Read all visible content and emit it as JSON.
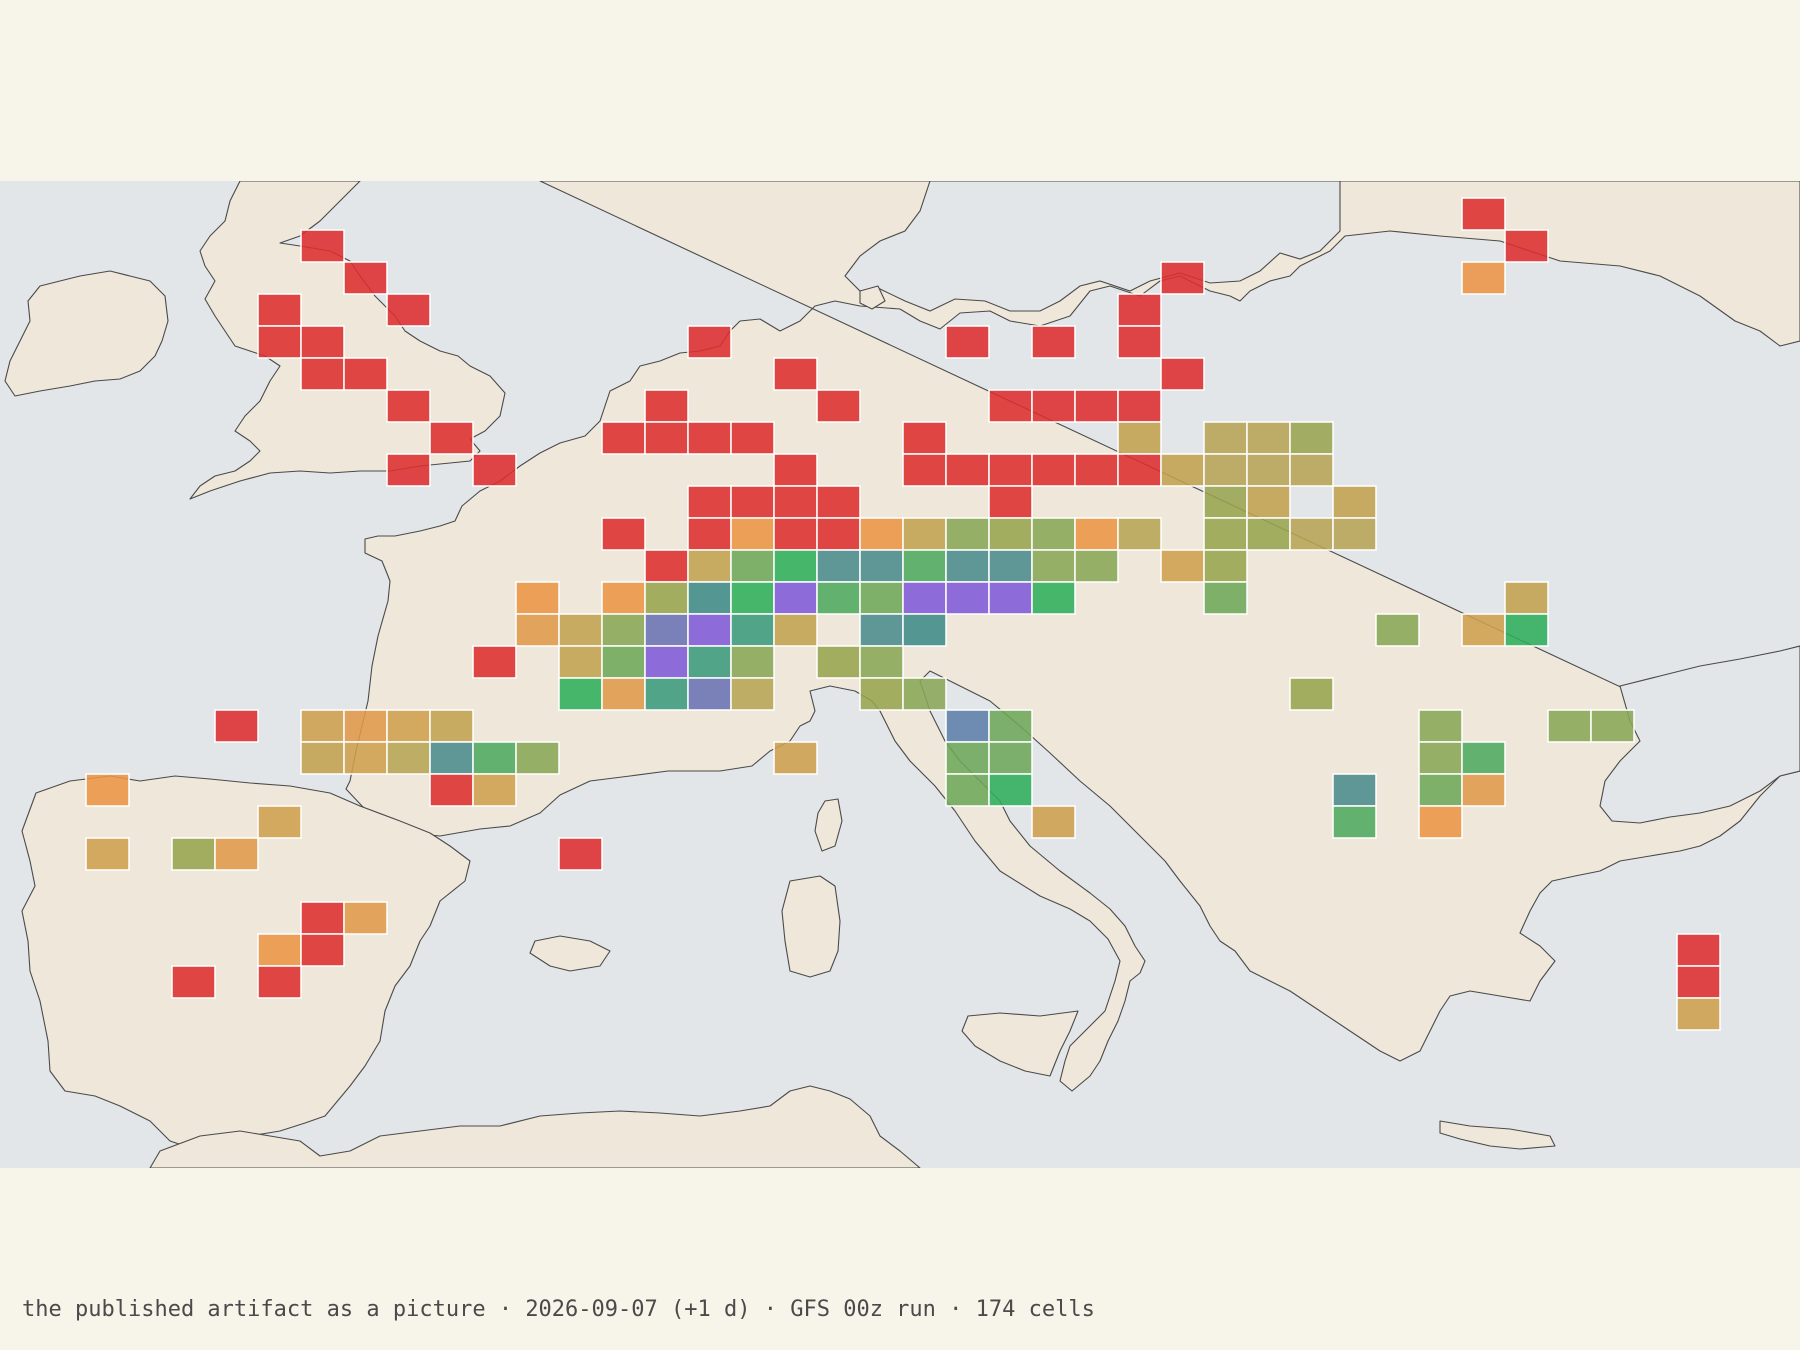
{
  "map": {
    "colors": {
      "page_background": "#f7f4ea",
      "sea": "#e3e6e8",
      "land": "#efe8da",
      "coastline": "#4a4a4a",
      "cell_border": "#ffffff"
    },
    "cell_count": 174,
    "palette": {
      "r": "#dd2e2e",
      "o": "#ec9444",
      "q": "#e0984a",
      "t": "#ce9f4c",
      "k": "#c2a24e",
      "y": "#b7a454",
      "v": "#98a44f",
      "g": "#8aa656",
      "l": "#6ea75a",
      "m": "#4fa85e",
      "e": "#2fae5b",
      "c": "#3b9a7b",
      "s": "#4a8b8c",
      "n": "#3d8a88",
      "b": "#5d7fa8",
      "i": "#6a72b4",
      "u": "#7f5ad8"
    },
    "cells": [
      [
        7,
        3,
        "r"
      ],
      [
        8,
        4,
        "r"
      ],
      [
        6,
        5,
        "r"
      ],
      [
        9,
        5,
        "r"
      ],
      [
        6,
        6,
        "r"
      ],
      [
        7,
        6,
        "r"
      ],
      [
        7,
        7,
        "r"
      ],
      [
        8,
        7,
        "r"
      ],
      [
        9,
        8,
        "r"
      ],
      [
        10,
        9,
        "r"
      ],
      [
        9,
        10,
        "r"
      ],
      [
        11,
        10,
        "r"
      ],
      [
        34,
        2,
        "r"
      ],
      [
        35,
        3,
        "r"
      ],
      [
        34,
        4,
        "o"
      ],
      [
        27,
        4,
        "r"
      ],
      [
        26,
        5,
        "r"
      ],
      [
        16,
        6,
        "r"
      ],
      [
        22,
        6,
        "r"
      ],
      [
        24,
        6,
        "r"
      ],
      [
        26,
        6,
        "r"
      ],
      [
        18,
        7,
        "r"
      ],
      [
        27,
        7,
        "r"
      ],
      [
        15,
        8,
        "r"
      ],
      [
        19,
        8,
        "r"
      ],
      [
        23,
        8,
        "r"
      ],
      [
        24,
        8,
        "r"
      ],
      [
        25,
        8,
        "r"
      ],
      [
        26,
        8,
        "r"
      ],
      [
        14,
        9,
        "r"
      ],
      [
        15,
        9,
        "r"
      ],
      [
        16,
        9,
        "r"
      ],
      [
        17,
        9,
        "r"
      ],
      [
        21,
        9,
        "r"
      ],
      [
        26,
        9,
        "k"
      ],
      [
        28,
        9,
        "y"
      ],
      [
        29,
        9,
        "y"
      ],
      [
        30,
        9,
        "v"
      ],
      [
        18,
        10,
        "r"
      ],
      [
        21,
        10,
        "r"
      ],
      [
        22,
        10,
        "r"
      ],
      [
        23,
        10,
        "r"
      ],
      [
        24,
        10,
        "r"
      ],
      [
        25,
        10,
        "r"
      ],
      [
        26,
        10,
        "r"
      ],
      [
        27,
        10,
        "k"
      ],
      [
        28,
        10,
        "y"
      ],
      [
        29,
        10,
        "y"
      ],
      [
        30,
        10,
        "y"
      ],
      [
        16,
        11,
        "r"
      ],
      [
        17,
        11,
        "r"
      ],
      [
        18,
        11,
        "r"
      ],
      [
        19,
        11,
        "r"
      ],
      [
        23,
        11,
        "r"
      ],
      [
        28,
        11,
        "v"
      ],
      [
        29,
        11,
        "k"
      ],
      [
        31,
        11,
        "k"
      ],
      [
        14,
        12,
        "r"
      ],
      [
        16,
        12,
        "r"
      ],
      [
        17,
        12,
        "o"
      ],
      [
        18,
        12,
        "r"
      ],
      [
        19,
        12,
        "r"
      ],
      [
        20,
        12,
        "o"
      ],
      [
        21,
        12,
        "k"
      ],
      [
        22,
        12,
        "g"
      ],
      [
        23,
        12,
        "v"
      ],
      [
        24,
        12,
        "g"
      ],
      [
        25,
        12,
        "o"
      ],
      [
        26,
        12,
        "y"
      ],
      [
        28,
        12,
        "v"
      ],
      [
        29,
        12,
        "v"
      ],
      [
        30,
        12,
        "y"
      ],
      [
        31,
        12,
        "y"
      ],
      [
        15,
        13,
        "r"
      ],
      [
        16,
        13,
        "k"
      ],
      [
        17,
        13,
        "l"
      ],
      [
        18,
        13,
        "e"
      ],
      [
        19,
        13,
        "s"
      ],
      [
        20,
        13,
        "s"
      ],
      [
        21,
        13,
        "m"
      ],
      [
        22,
        13,
        "s"
      ],
      [
        23,
        13,
        "s"
      ],
      [
        24,
        13,
        "g"
      ],
      [
        25,
        13,
        "g"
      ],
      [
        27,
        13,
        "t"
      ],
      [
        28,
        13,
        "v"
      ],
      [
        12,
        14,
        "o"
      ],
      [
        14,
        14,
        "o"
      ],
      [
        15,
        14,
        "v"
      ],
      [
        16,
        14,
        "n"
      ],
      [
        17,
        14,
        "e"
      ],
      [
        18,
        14,
        "u"
      ],
      [
        19,
        14,
        "m"
      ],
      [
        20,
        14,
        "l"
      ],
      [
        21,
        14,
        "u"
      ],
      [
        22,
        14,
        "u"
      ],
      [
        23,
        14,
        "u"
      ],
      [
        24,
        14,
        "e"
      ],
      [
        28,
        14,
        "l"
      ],
      [
        35,
        14,
        "k"
      ],
      [
        12,
        15,
        "q"
      ],
      [
        13,
        15,
        "k"
      ],
      [
        14,
        15,
        "g"
      ],
      [
        15,
        15,
        "i"
      ],
      [
        16,
        15,
        "u"
      ],
      [
        17,
        15,
        "c"
      ],
      [
        18,
        15,
        "k"
      ],
      [
        20,
        15,
        "s"
      ],
      [
        21,
        15,
        "n"
      ],
      [
        32,
        15,
        "g"
      ],
      [
        34,
        15,
        "t"
      ],
      [
        35,
        15,
        "e"
      ],
      [
        11,
        16,
        "r"
      ],
      [
        13,
        16,
        "k"
      ],
      [
        14,
        16,
        "l"
      ],
      [
        15,
        16,
        "u"
      ],
      [
        16,
        16,
        "c"
      ],
      [
        17,
        16,
        "g"
      ],
      [
        19,
        16,
        "v"
      ],
      [
        20,
        16,
        "g"
      ],
      [
        13,
        17,
        "e"
      ],
      [
        14,
        17,
        "q"
      ],
      [
        15,
        17,
        "c"
      ],
      [
        16,
        17,
        "i"
      ],
      [
        17,
        17,
        "y"
      ],
      [
        20,
        17,
        "v"
      ],
      [
        21,
        17,
        "g"
      ],
      [
        30,
        17,
        "v"
      ],
      [
        5,
        18,
        "r"
      ],
      [
        7,
        18,
        "t"
      ],
      [
        8,
        18,
        "q"
      ],
      [
        9,
        18,
        "t"
      ],
      [
        10,
        18,
        "k"
      ],
      [
        22,
        18,
        "b"
      ],
      [
        23,
        18,
        "l"
      ],
      [
        33,
        18,
        "g"
      ],
      [
        36,
        18,
        "g"
      ],
      [
        37,
        18,
        "g"
      ],
      [
        7,
        19,
        "k"
      ],
      [
        8,
        19,
        "t"
      ],
      [
        9,
        19,
        "y"
      ],
      [
        10,
        19,
        "s"
      ],
      [
        11,
        19,
        "m"
      ],
      [
        12,
        19,
        "g"
      ],
      [
        18,
        19,
        "t"
      ],
      [
        22,
        19,
        "l"
      ],
      [
        23,
        19,
        "l"
      ],
      [
        33,
        19,
        "g"
      ],
      [
        34,
        19,
        "m"
      ],
      [
        2,
        20,
        "o"
      ],
      [
        10,
        20,
        "r"
      ],
      [
        11,
        20,
        "t"
      ],
      [
        22,
        20,
        "l"
      ],
      [
        23,
        20,
        "e"
      ],
      [
        31,
        20,
        "s"
      ],
      [
        33,
        20,
        "l"
      ],
      [
        34,
        20,
        "q"
      ],
      [
        6,
        21,
        "t"
      ],
      [
        24,
        21,
        "t"
      ],
      [
        31,
        21,
        "m"
      ],
      [
        33,
        21,
        "o"
      ],
      [
        2,
        22,
        "t"
      ],
      [
        4,
        22,
        "v"
      ],
      [
        5,
        22,
        "q"
      ],
      [
        13,
        22,
        "r"
      ],
      [
        7,
        24,
        "r"
      ],
      [
        8,
        24,
        "q"
      ],
      [
        6,
        25,
        "o"
      ],
      [
        7,
        25,
        "r"
      ],
      [
        39,
        25,
        "r"
      ],
      [
        4,
        26,
        "r"
      ],
      [
        6,
        26,
        "r"
      ],
      [
        39,
        26,
        "r"
      ],
      [
        39,
        27,
        "t"
      ]
    ]
  },
  "caption": {
    "text": "the published artifact as a picture · 2026-09-07 (+1 d) · GFS 00z run · 174 cells"
  }
}
